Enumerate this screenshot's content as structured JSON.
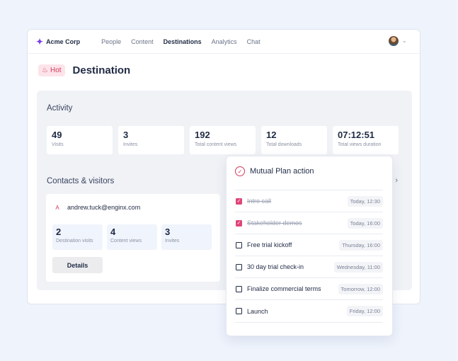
{
  "app": {
    "brand": "Acme Corp",
    "brand_icon": "sparkle-icon"
  },
  "nav": [
    {
      "label": "People",
      "active": false
    },
    {
      "label": "Content",
      "active": false
    },
    {
      "label": "Destinations",
      "active": true
    },
    {
      "label": "Analytics",
      "active": false
    },
    {
      "label": "Chat",
      "active": false
    }
  ],
  "page": {
    "badge": "Hot",
    "title": "Destination"
  },
  "activity": {
    "title": "Activity",
    "stats": [
      {
        "value": "49",
        "label": "Visits"
      },
      {
        "value": "3",
        "label": "Invites"
      },
      {
        "value": "192",
        "label": "Total content views"
      },
      {
        "value": "12",
        "label": "Total downloads"
      },
      {
        "value": "07:12:51",
        "label": "Total views duration"
      }
    ]
  },
  "contacts": {
    "title": "Contacts & visitors",
    "contact": {
      "initial": "A",
      "email": "andrew.tuck@enginx.com"
    },
    "stats": [
      {
        "value": "2",
        "label": "Destination visits"
      },
      {
        "value": "4",
        "label": "Content views"
      },
      {
        "value": "3",
        "label": "Invites"
      }
    ],
    "details_label": "Details"
  },
  "plan": {
    "title": "Mutual Plan action",
    "items": [
      {
        "label": "Intro call",
        "time": "Today, 12:30",
        "done": true
      },
      {
        "label": "Stakeholder demos",
        "time": "Today, 16:00",
        "done": true
      },
      {
        "label": "Free trial kickoff",
        "time": "Thursday, 16:00",
        "done": false
      },
      {
        "label": "30 day trial check-in",
        "time": "Wednesday, 11:00",
        "done": false
      },
      {
        "label": "Finalize commercial terms",
        "time": "Tomorrow, 12:00",
        "done": false
      },
      {
        "label": "Launch",
        "time": "Friday, 12:00",
        "done": false
      }
    ]
  },
  "colors": {
    "accent": "#d23a5a",
    "checkbox": "#e0467a",
    "background": "#eef3fc"
  }
}
